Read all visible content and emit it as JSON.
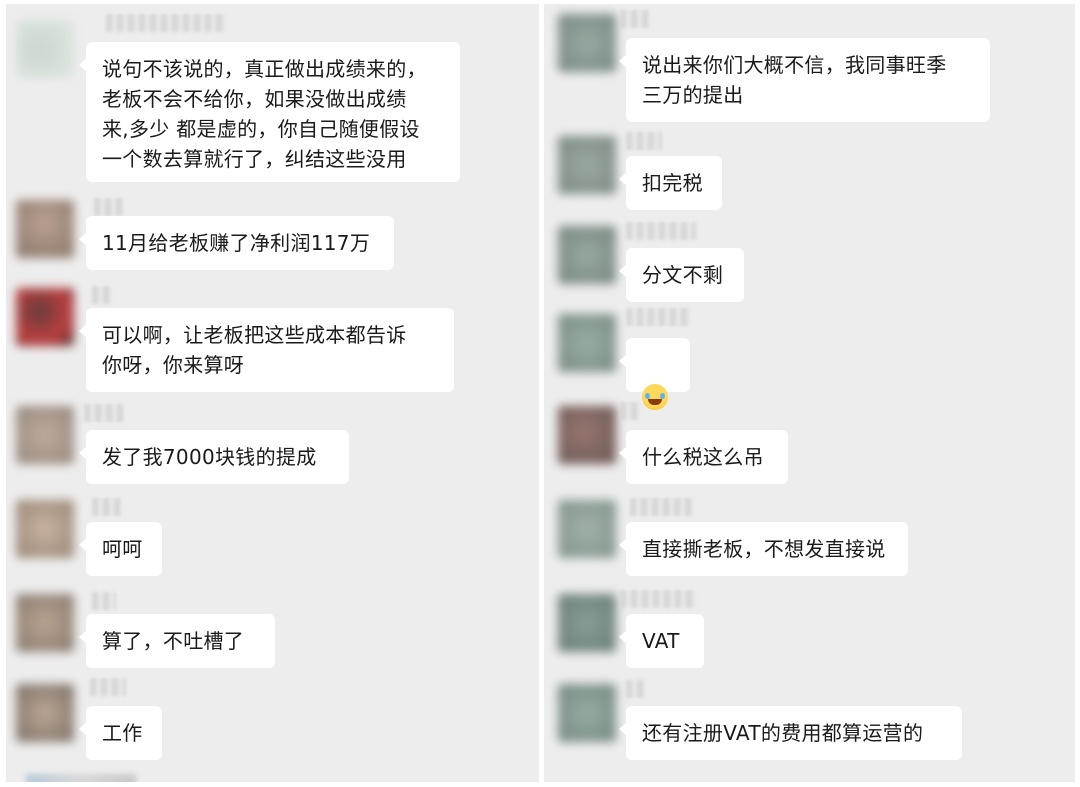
{
  "left_chat": {
    "messages": [
      {
        "text": "说句不该说的，真正做出成绩来的，\n老板不会不给你，如果没做出成绩\n来,多少 都是虚的，你自己随便假设\n一个数去算就行了，纠结这些没用"
      },
      {
        "text": "11月给老板赚了净利润117万"
      },
      {
        "text": "可以啊，让老板把这些成本都告诉\n你呀，你来算呀"
      },
      {
        "text": "发了我7000块钱的提成"
      },
      {
        "text": "呵呵"
      },
      {
        "text": "算了，不吐槽了"
      },
      {
        "text": "工作"
      }
    ]
  },
  "right_chat": {
    "messages": [
      {
        "text": "说出来你们大概不信，我同事旺季\n三万的提出"
      },
      {
        "text": "扣完税"
      },
      {
        "text": "分文不剩"
      },
      {
        "text": "",
        "emoji": "laughing-with-tears-emoji"
      },
      {
        "text": "什么税这么吊"
      },
      {
        "text": "直接撕老板，不想发直接说"
      },
      {
        "text": "VAT"
      },
      {
        "text": "还有注册VAT的费用都算运营的"
      }
    ]
  },
  "colors": {
    "chat_background": "#ededed",
    "bubble": "#ffffff",
    "text": "#1a1a1a"
  }
}
